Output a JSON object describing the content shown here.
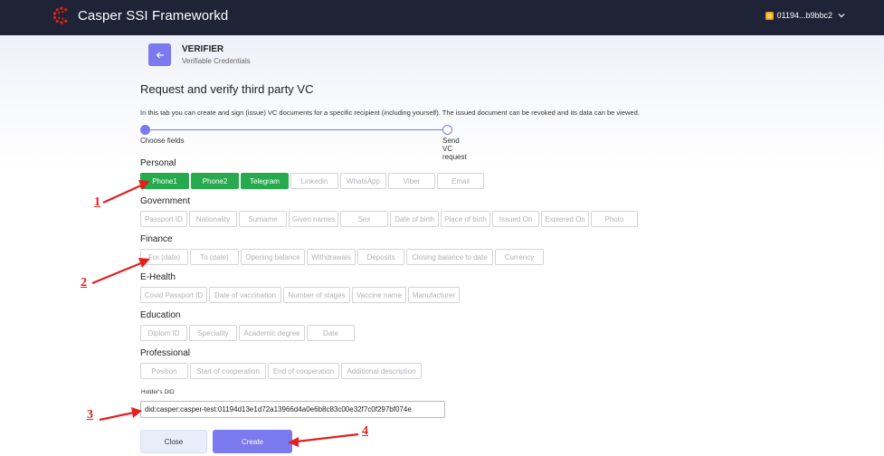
{
  "app": {
    "title": "Casper SSI Frameworkd",
    "account": "01194...b9bbc2",
    "logo_color": "#e0211e",
    "header_bg": "#1e2336"
  },
  "section": {
    "title": "VERIFIER",
    "subtitle": "Verifiable Credentials",
    "back_icon": "arrow-left-icon"
  },
  "page": {
    "title": "Request and verify third party VC",
    "description": "In this tab you can create and sign (issue) VC documents for a specific recipient (including yourself). The issued document can be revoked and its data can be viewed."
  },
  "stepper": {
    "steps": [
      "Choose fields",
      "Send VC request"
    ],
    "active_step": 0
  },
  "categories": [
    {
      "title": "Personal",
      "chips": [
        {
          "label": "Phone1",
          "selected": true
        },
        {
          "label": "Phone2",
          "selected": true
        },
        {
          "label": "Telegram",
          "selected": true
        },
        {
          "label": "Linkedin",
          "selected": false
        },
        {
          "label": "WhatsApp",
          "selected": false
        },
        {
          "label": "Viber",
          "selected": false
        },
        {
          "label": "Email",
          "selected": false
        }
      ]
    },
    {
      "title": "Government",
      "chips": [
        {
          "label": "Passport ID",
          "selected": false
        },
        {
          "label": "Nationality",
          "selected": false
        },
        {
          "label": "Surname",
          "selected": false
        },
        {
          "label": "Given names",
          "selected": false
        },
        {
          "label": "Sex",
          "selected": false
        },
        {
          "label": "Date of birth",
          "selected": false
        },
        {
          "label": "Place of birth",
          "selected": false
        },
        {
          "label": "Issued On",
          "selected": false
        },
        {
          "label": "Expiered On",
          "selected": false
        },
        {
          "label": "Photo",
          "selected": false
        }
      ]
    },
    {
      "title": "Finance",
      "chips": [
        {
          "label": "For (date)",
          "selected": false
        },
        {
          "label": "To (date)",
          "selected": false
        },
        {
          "label": "Opening balance",
          "selected": false
        },
        {
          "label": "Withdrawals",
          "selected": false
        },
        {
          "label": "Deposits",
          "selected": false
        },
        {
          "label": "Closing balance to date",
          "selected": false
        },
        {
          "label": "Currency",
          "selected": false
        }
      ]
    },
    {
      "title": "E-Health",
      "chips": [
        {
          "label": "Covid Passport ID",
          "selected": false
        },
        {
          "label": "Date of vaccination",
          "selected": false
        },
        {
          "label": "Number of stages",
          "selected": false
        },
        {
          "label": "Vaccine name",
          "selected": false
        },
        {
          "label": "Manufacturer",
          "selected": false
        }
      ]
    },
    {
      "title": "Education",
      "chips": [
        {
          "label": "Diplom ID",
          "selected": false
        },
        {
          "label": "Speciality",
          "selected": false
        },
        {
          "label": "Academic degree",
          "selected": false
        },
        {
          "label": "Date",
          "selected": false
        }
      ]
    },
    {
      "title": "Professional",
      "chips": [
        {
          "label": "Position",
          "selected": false
        },
        {
          "label": "Start of cooperation",
          "selected": false
        },
        {
          "label": "End of cooperation",
          "selected": false
        },
        {
          "label": "Additional description",
          "selected": false
        }
      ]
    }
  ],
  "holder": {
    "label": "Holder's DID",
    "value": "did:casper:casper-test:01194d13e1d72a13966d4a0e6b8c83c00e32f7c0f297bf074e"
  },
  "buttons": {
    "close": "Close",
    "create": "Create"
  },
  "annotations": [
    "1",
    "2",
    "3",
    "4"
  ],
  "colors": {
    "accent": "#7b79ee",
    "selected_chip": "#27a94e",
    "annotation": "#e0211e"
  }
}
